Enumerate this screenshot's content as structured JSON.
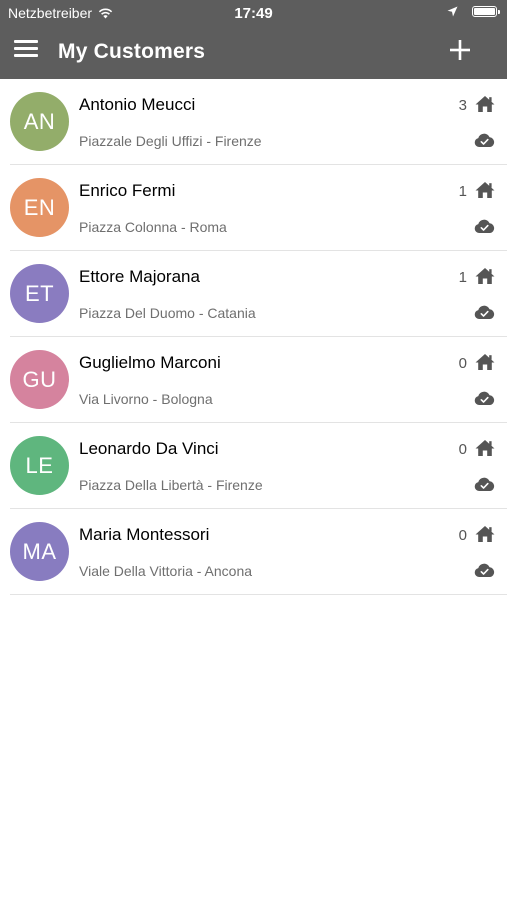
{
  "status_bar": {
    "carrier": "Netzbetreiber",
    "time": "17:49"
  },
  "header": {
    "title": "My Customers"
  },
  "colors": {
    "header_bg": "#5d5d5d",
    "icon_gray": "#555555"
  },
  "customers": [
    {
      "initials": "AN",
      "name": "Antonio Meucci",
      "address": "Piazzale Degli Uffizi - Firenze",
      "count": "3",
      "avatar_color": "#93ad6a"
    },
    {
      "initials": "EN",
      "name": "Enrico Fermi",
      "address": "Piazza Colonna - Roma",
      "count": "1",
      "avatar_color": "#e59466"
    },
    {
      "initials": "ET",
      "name": "Ettore Majorana",
      "address": "Piazza Del Duomo - Catania",
      "count": "1",
      "avatar_color": "#8a7cc0"
    },
    {
      "initials": "GU",
      "name": "Guglielmo Marconi",
      "address": "Via Livorno - Bologna",
      "count": "0",
      "avatar_color": "#d5839e"
    },
    {
      "initials": "LE",
      "name": "Leonardo Da Vinci",
      "address": "Piazza Della Libertà - Firenze",
      "count": "0",
      "avatar_color": "#5fb67e"
    },
    {
      "initials": "MA",
      "name": "Maria Montessori",
      "address": "Viale Della Vittoria - Ancona",
      "count": "0",
      "avatar_color": "#887cc0"
    }
  ]
}
